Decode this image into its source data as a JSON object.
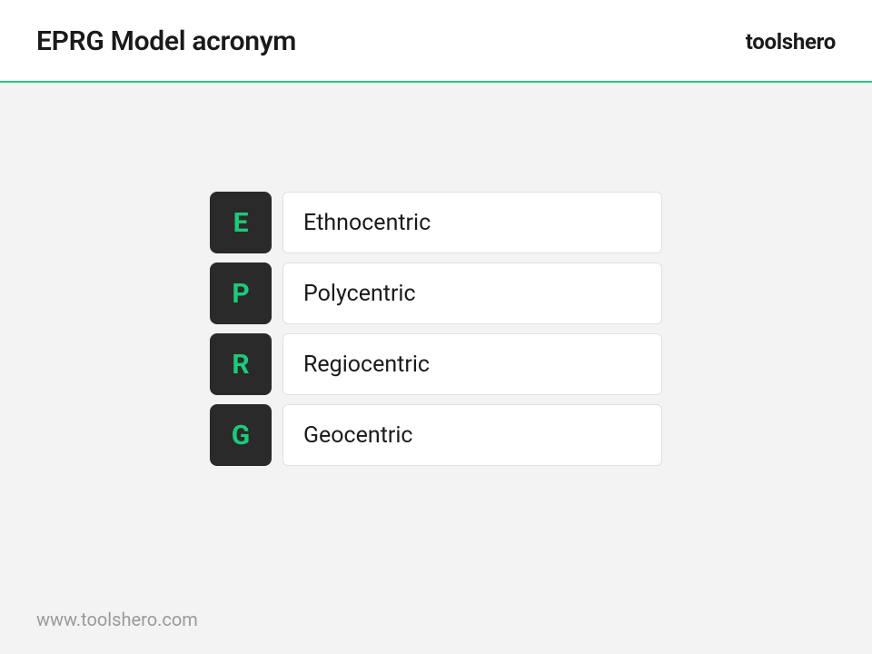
{
  "header": {
    "title": "EPRG Model acronym",
    "brand": "toolshero"
  },
  "acronym": {
    "items": [
      {
        "letter": "E",
        "label": "Ethnocentric"
      },
      {
        "letter": "P",
        "label": "Polycentric"
      },
      {
        "letter": "R",
        "label": "Regiocentric"
      },
      {
        "letter": "G",
        "label": "Geocentric"
      }
    ]
  },
  "footer": {
    "url": "www.toolshero.com"
  }
}
